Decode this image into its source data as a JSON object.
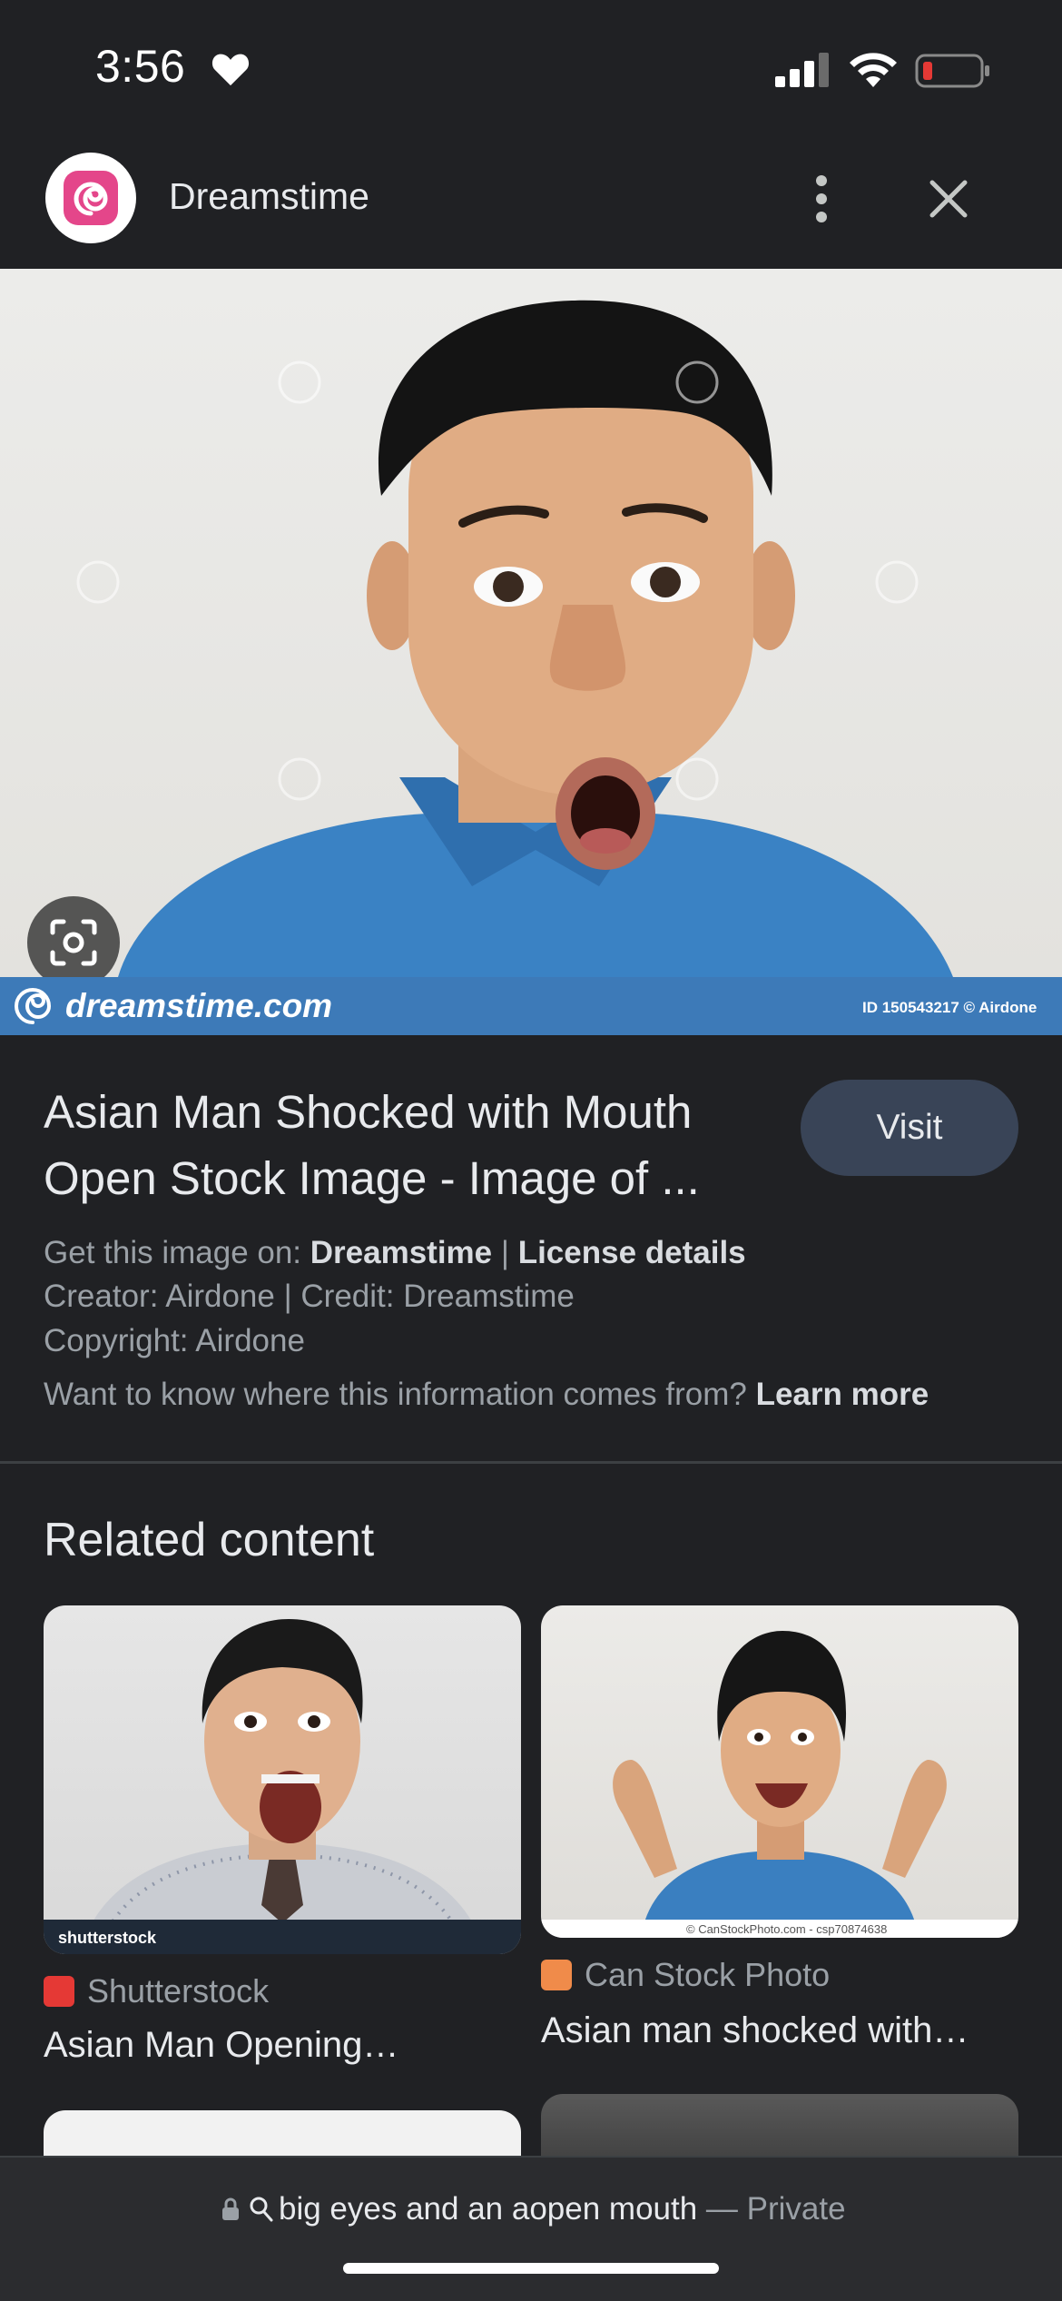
{
  "status_bar": {
    "time": "3:56",
    "icons": [
      "heart-icon",
      "signal-icon",
      "wifi-icon",
      "battery-icon"
    ],
    "battery_color": "#e53935"
  },
  "header": {
    "site_name": "Dreamstime",
    "logo_icon": "dreamstime-swirl-logo",
    "logo_color": "#e4468a"
  },
  "image": {
    "banner_brand": "dreamstime.com",
    "banner_id": "ID 150543217 © Airdone",
    "banner_color": "#3d7ab8"
  },
  "result": {
    "title": "Asian Man Shocked with Mouth Open Stock Image - Image of ...",
    "visit_label": "Visit",
    "get_image_prefix": "Get this image on: ",
    "get_image_site": "Dreamstime",
    "separator": " | ",
    "license_link": "License details",
    "creator_line": "Creator: Airdone | Credit: Dreamstime",
    "copyright_line": "Copyright: Airdone",
    "info_question": "Want to know where this information comes from? ",
    "learn_more": "Learn more"
  },
  "related": {
    "heading": "Related content",
    "items": [
      {
        "source": "Shutterstock",
        "title": "Asian Man Opening…",
        "watermark": "shutterstock",
        "source_color": "#e53935"
      },
      {
        "source": "Can Stock Photo",
        "title": "Asian man shocked with…",
        "watermark": "© CanStockPhoto.com - csp70874638",
        "source_color": "#f08b4a"
      }
    ]
  },
  "address_bar": {
    "query": "big eyes and an aopen mouth",
    "dash": " — ",
    "mode": "Private"
  }
}
